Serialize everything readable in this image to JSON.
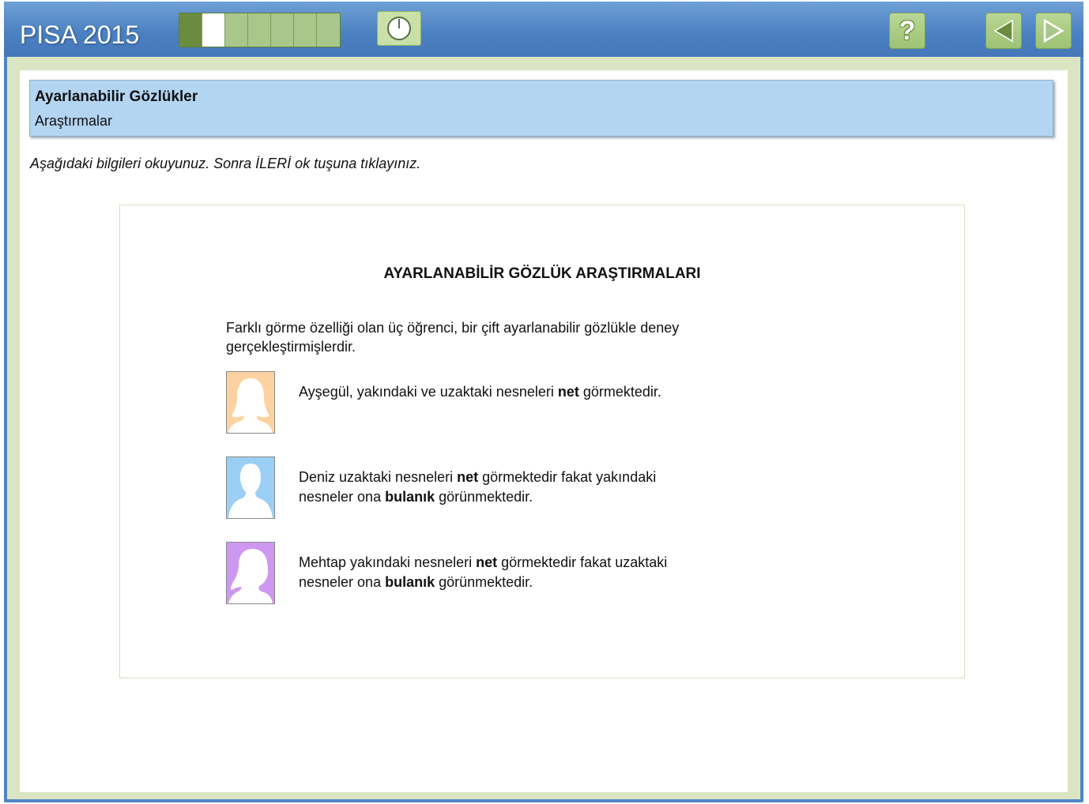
{
  "app": {
    "title": "PISA 2015",
    "progress": {
      "total": 7,
      "completed": 1,
      "current": 2
    }
  },
  "toolbar": {
    "timer_icon": "clock-icon",
    "help_icon": "help-icon",
    "help_label": "?",
    "prev_icon": "left-arrow-icon",
    "next_icon": "right-arrow-icon"
  },
  "header": {
    "unit_title": "Ayarlanabilir Gözlükler",
    "subtitle": "Araştırmalar"
  },
  "instruction": "Aşağıdaki bilgileri okuyunuz. Sonra İLERİ ok tuşuna tıklayınız.",
  "stimulus": {
    "title": "AYARLANABİLİR GÖZLÜK ARAŞTIRMALARI",
    "intro": "Farklı görme özelliği olan üç öğrenci, bir çift ayarlanabilir gözlükle deney gerçekleştirmişlerdir.",
    "people": [
      {
        "name": "Ayşegül",
        "avatar_color": "#fcd3a0",
        "line1_a": "Ayşegül, yakındaki ve uzaktaki nesneleri ",
        "line1_b": "net",
        "line1_c": " görmektedir.",
        "line2_a": "",
        "line2_b": "",
        "line2_c": ""
      },
      {
        "name": "Deniz",
        "avatar_color": "#9ccff5",
        "line1_a": "Deniz uzaktaki nesneleri ",
        "line1_b": "net",
        "line1_c": " görmektedir fakat yakındaki",
        "line2_a": "nesneler ona ",
        "line2_b": "bulanık",
        "line2_c": " görünmektedir."
      },
      {
        "name": "Mehtap",
        "avatar_color": "#cf98f0",
        "line1_a": "Mehtap yakındaki nesneleri ",
        "line1_b": "net",
        "line1_c": " görmektedir fakat uzaktaki",
        "line2_a": "nesneler ona ",
        "line2_b": "bulanık",
        "line2_c": " görünmektedir."
      }
    ]
  },
  "colors": {
    "topbar": "#4f86c6",
    "header_box": "#b3d5f2",
    "frame": "#dce5c3",
    "button_green": "#a9c78a"
  }
}
